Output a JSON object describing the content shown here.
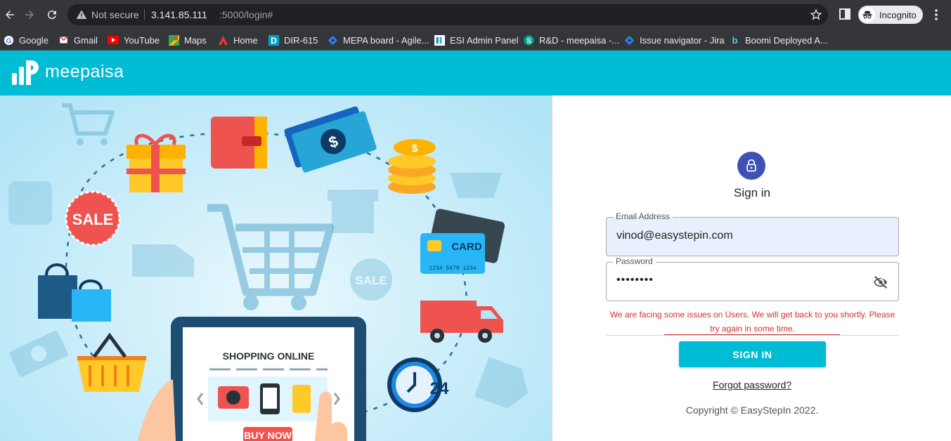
{
  "browser": {
    "security_label": "Not secure",
    "url_host": "3.141.85.111",
    "url_path": ":5000/login#",
    "incognito_label": "Incognito"
  },
  "bookmarks": [
    {
      "label": "Google",
      "icon": "google-icon"
    },
    {
      "label": "Gmail",
      "icon": "gmail-icon"
    },
    {
      "label": "YouTube",
      "icon": "youtube-icon"
    },
    {
      "label": "Maps",
      "icon": "maps-icon"
    },
    {
      "label": "Home",
      "icon": "home-icon"
    },
    {
      "label": "DIR-615",
      "icon": "dlink-icon"
    },
    {
      "label": "MEPA board - Agile...",
      "icon": "jira-icon"
    },
    {
      "label": "ESI Admin Panel",
      "icon": "esi-icon"
    },
    {
      "label": "R&D - meepaisa -...",
      "icon": "s-icon"
    },
    {
      "label": "Issue navigator - Jira",
      "icon": "jira-icon"
    },
    {
      "label": "Boomi Deployed A...",
      "icon": "boomi-icon"
    }
  ],
  "header": {
    "brand": "meepaisa",
    "brand_color": "#00bcd4"
  },
  "illustration": {
    "sale_tag": "SALE",
    "card_text": "CARD",
    "card_number": "1234 5678 1234",
    "screen_title": "SHOPPING ONLINE",
    "buy_now": "BUY NOW",
    "clock_label": "24"
  },
  "login": {
    "title": "Sign in",
    "email_label": "Email Address",
    "email_value": "vinod@easystepin.com",
    "password_label": "Password",
    "password_value": "••••••••",
    "error": "We are facing some issues on Users. We will get back to you shortly. Please try again in some time.",
    "submit_label": "SIGN IN",
    "forgot_label": "Forgot password?",
    "copyright": "Copyright © EasyStepIn 2022."
  },
  "colors": {
    "accent": "#00bcd4",
    "avatar": "#3f51b5",
    "error": "#d32f2f",
    "autofill": "#e8f0fe"
  }
}
